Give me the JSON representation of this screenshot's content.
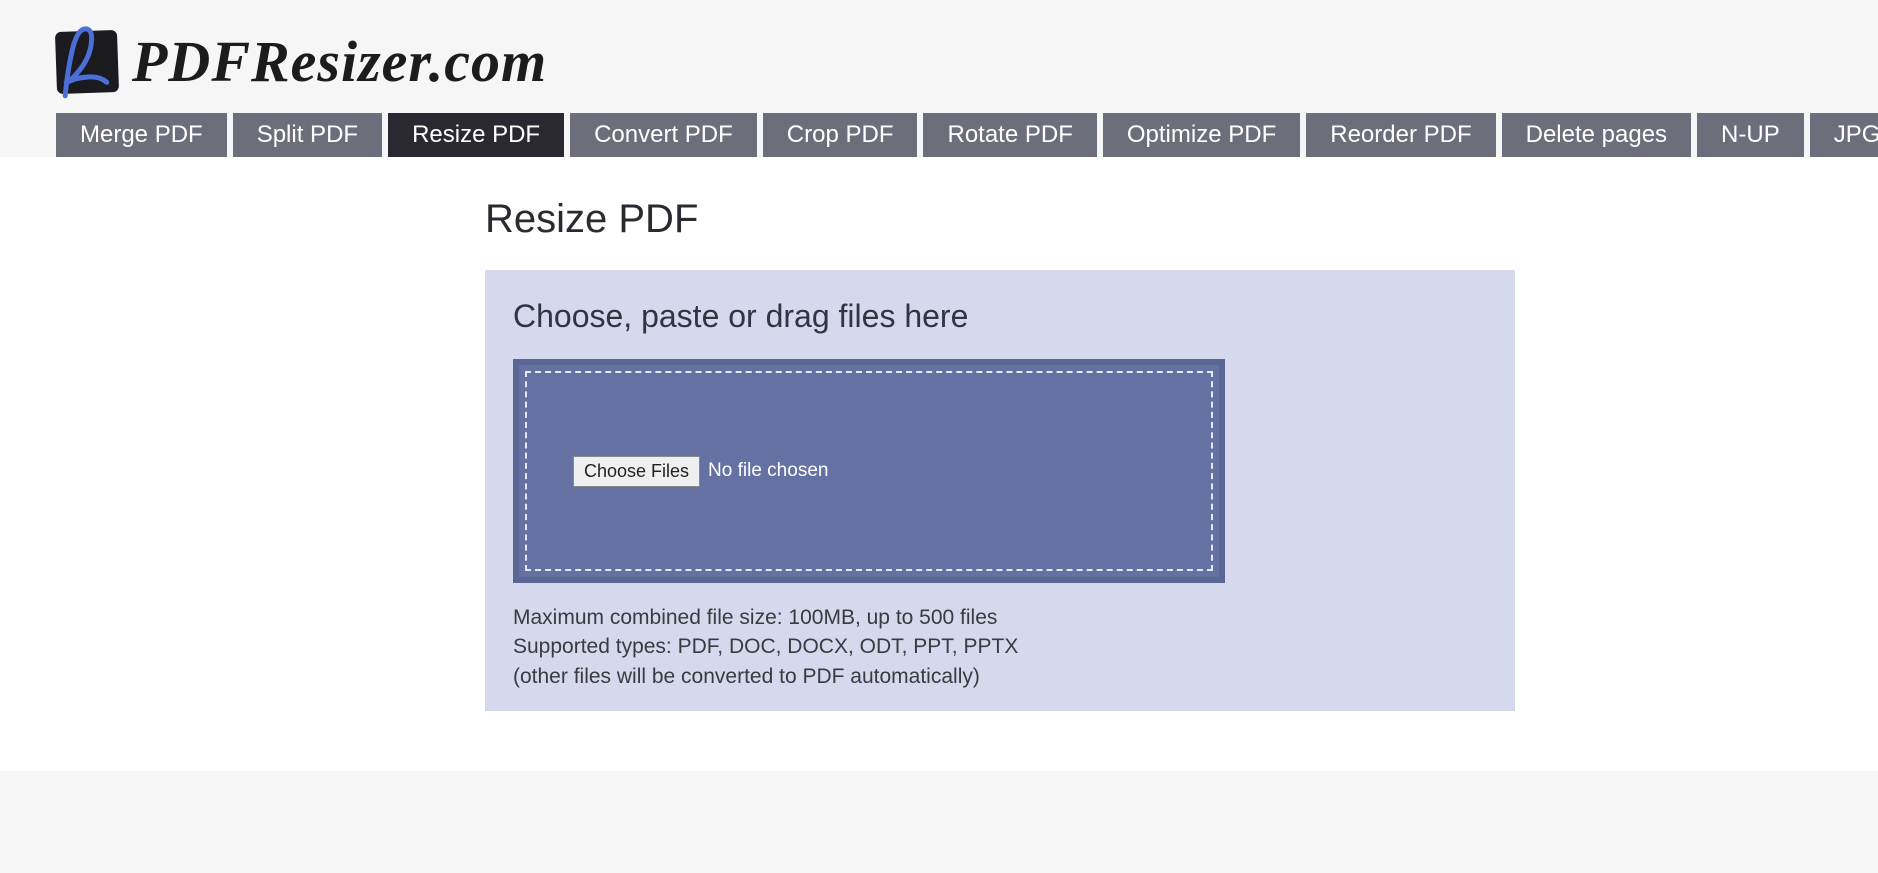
{
  "brand": "PDFResizer.com",
  "nav": [
    {
      "label": "Merge PDF",
      "active": false
    },
    {
      "label": "Split PDF",
      "active": false
    },
    {
      "label": "Resize PDF",
      "active": true
    },
    {
      "label": "Convert PDF",
      "active": false
    },
    {
      "label": "Crop PDF",
      "active": false
    },
    {
      "label": "Rotate PDF",
      "active": false
    },
    {
      "label": "Optimize PDF",
      "active": false
    },
    {
      "label": "Reorder PDF",
      "active": false
    },
    {
      "label": "Delete pages",
      "active": false
    },
    {
      "label": "N-UP",
      "active": false
    },
    {
      "label": "JPG to PDF",
      "active": false
    }
  ],
  "page": {
    "title": "Resize PDF",
    "upload_heading": "Choose, paste or drag files here",
    "choose_button": "Choose Files",
    "file_status": "No file chosen",
    "hint_size": "Maximum combined file size: 100MB, up to 500 files",
    "hint_types": "Supported types: PDF, DOC, DOCX, ODT, PPT, PPTX",
    "hint_convert": "(other files will be converted to PDF automatically)"
  }
}
